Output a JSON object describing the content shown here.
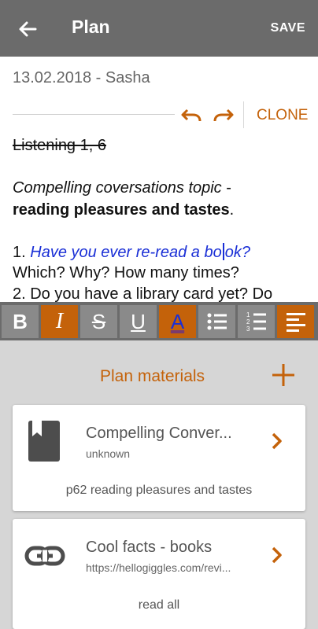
{
  "appbar": {
    "title": "Plan",
    "save_label": "SAVE",
    "back_icon": "arrow-left-icon"
  },
  "editor": {
    "date_author": "13.02.2018 - Sasha",
    "clone_label": "CLONE",
    "line1": "Listening 1,  6",
    "line2_italic": "Compelling coversations topic",
    "line2_rest": " -",
    "line3_bold": "reading pleasures and tastes",
    "line3_rest": ".",
    "line4_num": "1. ",
    "line4_q1": "Have you ever re-read a bo",
    "line4_q2": "ok?",
    "line5": "Which? Why? How many times?",
    "line6": "2. Do you have a library card yet? Do"
  },
  "toolbar": {
    "bold": "B",
    "italic": "I",
    "strike": "S",
    "underline": "U",
    "color": "A",
    "active": [
      "italic",
      "color",
      "align-left"
    ]
  },
  "materials": {
    "title": "Plan materials",
    "items": [
      {
        "title": "Compelling Conver...",
        "subtitle": "unknown",
        "description": "p62 reading pleasures and tastes",
        "icon": "bookmark-icon"
      },
      {
        "title": "Cool facts - books",
        "subtitle": "https://hellogiggles.com/revi...",
        "description": "read all",
        "icon": "link-icon"
      }
    ]
  },
  "colors": {
    "accent": "#c4620a",
    "appbar": "#6b6b6b",
    "text_blue": "#1a2fd6"
  }
}
